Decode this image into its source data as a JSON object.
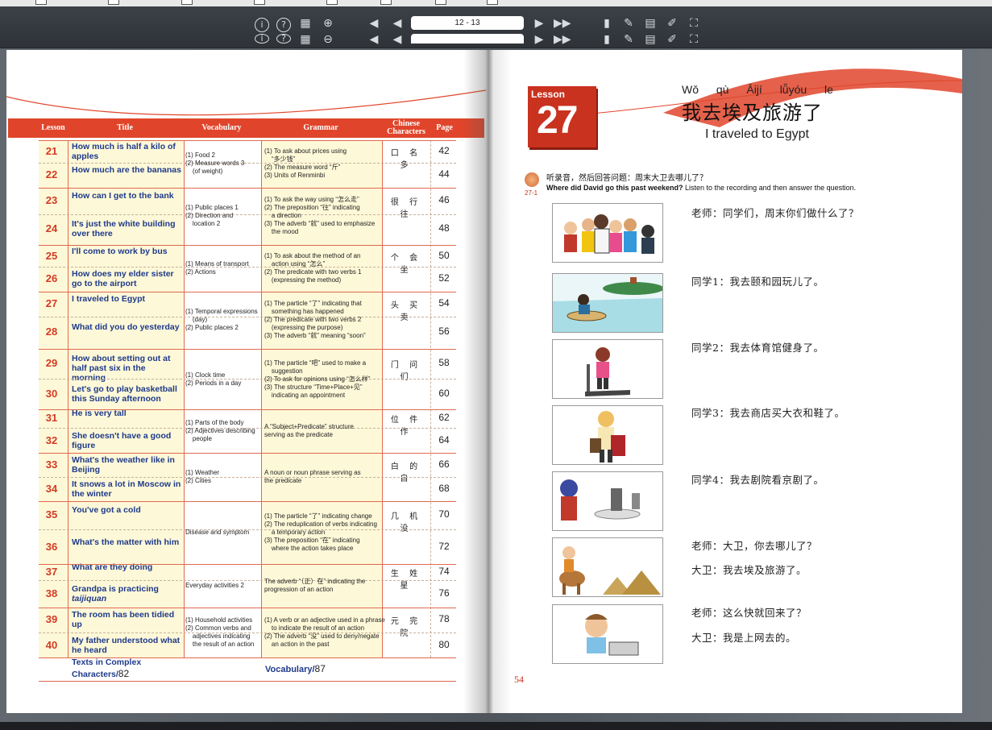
{
  "toolbar": {
    "page_indicator": "12 - 13",
    "icons": [
      "info-icon",
      "help-icon",
      "thumbnails-icon",
      "zoom-in-icon",
      "first-page-icon",
      "previous-page-icon",
      "next-page-icon",
      "last-page-icon",
      "bookmark-icon",
      "pen-icon",
      "notes-icon",
      "highlighter-icon",
      "fullscreen-icon"
    ]
  },
  "toc": {
    "headers": [
      "Lesson",
      "Title",
      "Vocabulary",
      "Grammar",
      "Chinese Characters",
      "Page"
    ],
    "lessons": [
      {
        "num": "21",
        "title": "How much is half a kilo of apples",
        "page": "42",
        "chars": "口 名 多"
      },
      {
        "num": "22",
        "title": "How much are the bananas",
        "page": "44",
        "chars": ""
      },
      {
        "num": "23",
        "title": "How can I get to the bank",
        "page": "46",
        "chars": "很 行 往"
      },
      {
        "num": "24",
        "title": "It's just the white building over there",
        "page": "48",
        "chars": ""
      },
      {
        "num": "25",
        "title": "I'll come to work by bus",
        "page": "50",
        "chars": "个 会 坐"
      },
      {
        "num": "26",
        "title": "How does my elder sister go to the airport",
        "page": "52",
        "chars": ""
      },
      {
        "num": "27",
        "title": "I traveled to Egypt",
        "page": "54",
        "chars": "头 买 卖"
      },
      {
        "num": "28",
        "title": "What did you do yesterday",
        "page": "56",
        "chars": ""
      },
      {
        "num": "29",
        "title": "How about setting out at half past six in the morning",
        "page": "58",
        "chars": "门 问 们"
      },
      {
        "num": "30",
        "title": "Let's go to play basketball this Sunday afternoon",
        "page": "60",
        "chars": ""
      },
      {
        "num": "31",
        "title": "He is very tall",
        "page": "62",
        "chars": "位 件 作"
      },
      {
        "num": "32",
        "title": "She doesn't have a good figure",
        "page": "64",
        "chars": ""
      },
      {
        "num": "33",
        "title": "What's the weather like in Beijing",
        "page": "66",
        "chars": "白 的 自"
      },
      {
        "num": "34",
        "title": "It snows a lot in Moscow in the winter",
        "page": "68",
        "chars": ""
      },
      {
        "num": "35",
        "title": "You've got a cold",
        "page": "70",
        "chars": "几 机 没"
      },
      {
        "num": "36",
        "title": "What's the matter with him",
        "page": "72",
        "chars": ""
      },
      {
        "num": "37",
        "title": "What are they doing",
        "page": "74",
        "chars": "生 姓 星"
      },
      {
        "num": "38",
        "title": "Grandpa is practicing",
        "title_italic": "taijiquan",
        "page": "76",
        "chars": ""
      },
      {
        "num": "39",
        "title": "The room has been tidied up",
        "page": "78",
        "chars": "元 完 院"
      },
      {
        "num": "40",
        "title": "My father understood what he heard",
        "page": "80",
        "chars": ""
      }
    ],
    "vocab_groups": [
      "(1) Food 2\n(2) Measure words 3\n    (of weight)",
      "(1) Public places 1\n(2) Direction and\n    location 2",
      "(1) Means of transport\n(2) Actions",
      "(1) Temporal expressions\n    (day)\n(2) Public places 2",
      "(1) Clock time\n(2) Periods in a day",
      "(1) Parts of the body\n(2) Adjectives describing\n    people",
      "(1) Weather\n(2) Cities",
      "Disease and symptom",
      "Everyday activities 2",
      "(1) Household activities\n(2) Common verbs and\n    adjectives indicating\n    the result of an action"
    ],
    "grammar_groups": [
      "(1) To ask about prices using\n    “多少钱”\n(2) The measure word “斤”\n(3) Units of Renminbi",
      "(1) To ask the way using “怎么走”\n(2) The preposition “往” indicating\n    a direction\n(3) The adverb “就” used to emphasize\n    the mood",
      "(1) To ask about the method of an\n    action using “怎么”\n(2) The predicate with two verbs 1\n    (expressing the method)",
      "(1) The particle “了” indicating that\n    something has happened\n(2) The predicate with two verbs 2\n    (expressing the purpose)\n(3) The adverb “就” meaning “soon”",
      "(1) The particle “吧” used to make a\n    suggestion\n(2) To ask for opinions using “怎么样”\n(3) The structure “Time+Place+见”\n    indicating an appointment",
      "A “Subject+Predicate” structure\nserving as the predicate",
      "A noun or noun phrase serving as\nthe predicate",
      "(1) The particle “了” indicating change\n(2) The reduplication of verbs indicating\n    a temporary action\n(3) The preposition “在” indicating\n    where the action takes place",
      "The adverb “（正）在” indicating the\nprogression of an action",
      "(1) A verb or an adjective used in a phrase\n    to indicate the result of an action\n(2) The adverb “没” used to deny/negate\n    an action in the past"
    ],
    "footer": {
      "complex_label_1": "Texts in Complex",
      "complex_label_2": "Characters/",
      "complex_page": "82",
      "vocab_label": "Vocabulary/",
      "vocab_page": "87"
    }
  },
  "lesson": {
    "badge_label": "Lesson",
    "badge_number": "27",
    "pinyin": "Wǒ qù Āijí lǚyóu le",
    "chinese_title": "我去埃及旅游了",
    "english_title": "I traveled to Egypt",
    "track": "27-1",
    "instruction_cn": "听录音，然后回答问题：周末大卫去哪儿了？",
    "instruction_en_bold": "Where did David go this past weekend?",
    "instruction_en": " Listen to the recording and then answer the question.",
    "dialogue": [
      {
        "line": "老师：同学们，周末你们做什么了？"
      },
      {
        "line": "同学1：我去颐和园玩儿了。"
      },
      {
        "line": "同学2：我去体育馆健身了。"
      },
      {
        "line": "同学3：我去商店买大衣和鞋了。"
      },
      {
        "line": "同学4：我去剧院看京剧了。"
      },
      {
        "line": "老师：大卫，你去哪儿了？"
      },
      {
        "line": "大卫：我去埃及旅游了。"
      },
      {
        "line": "老师：这么快就回来了？"
      },
      {
        "line": "大卫：我是上网去的。"
      }
    ],
    "page_number": "54"
  },
  "colors": {
    "accent_red": "#e0452b",
    "title_blue": "#1e3a8a",
    "shade_yellow": "#fdf8d8"
  }
}
